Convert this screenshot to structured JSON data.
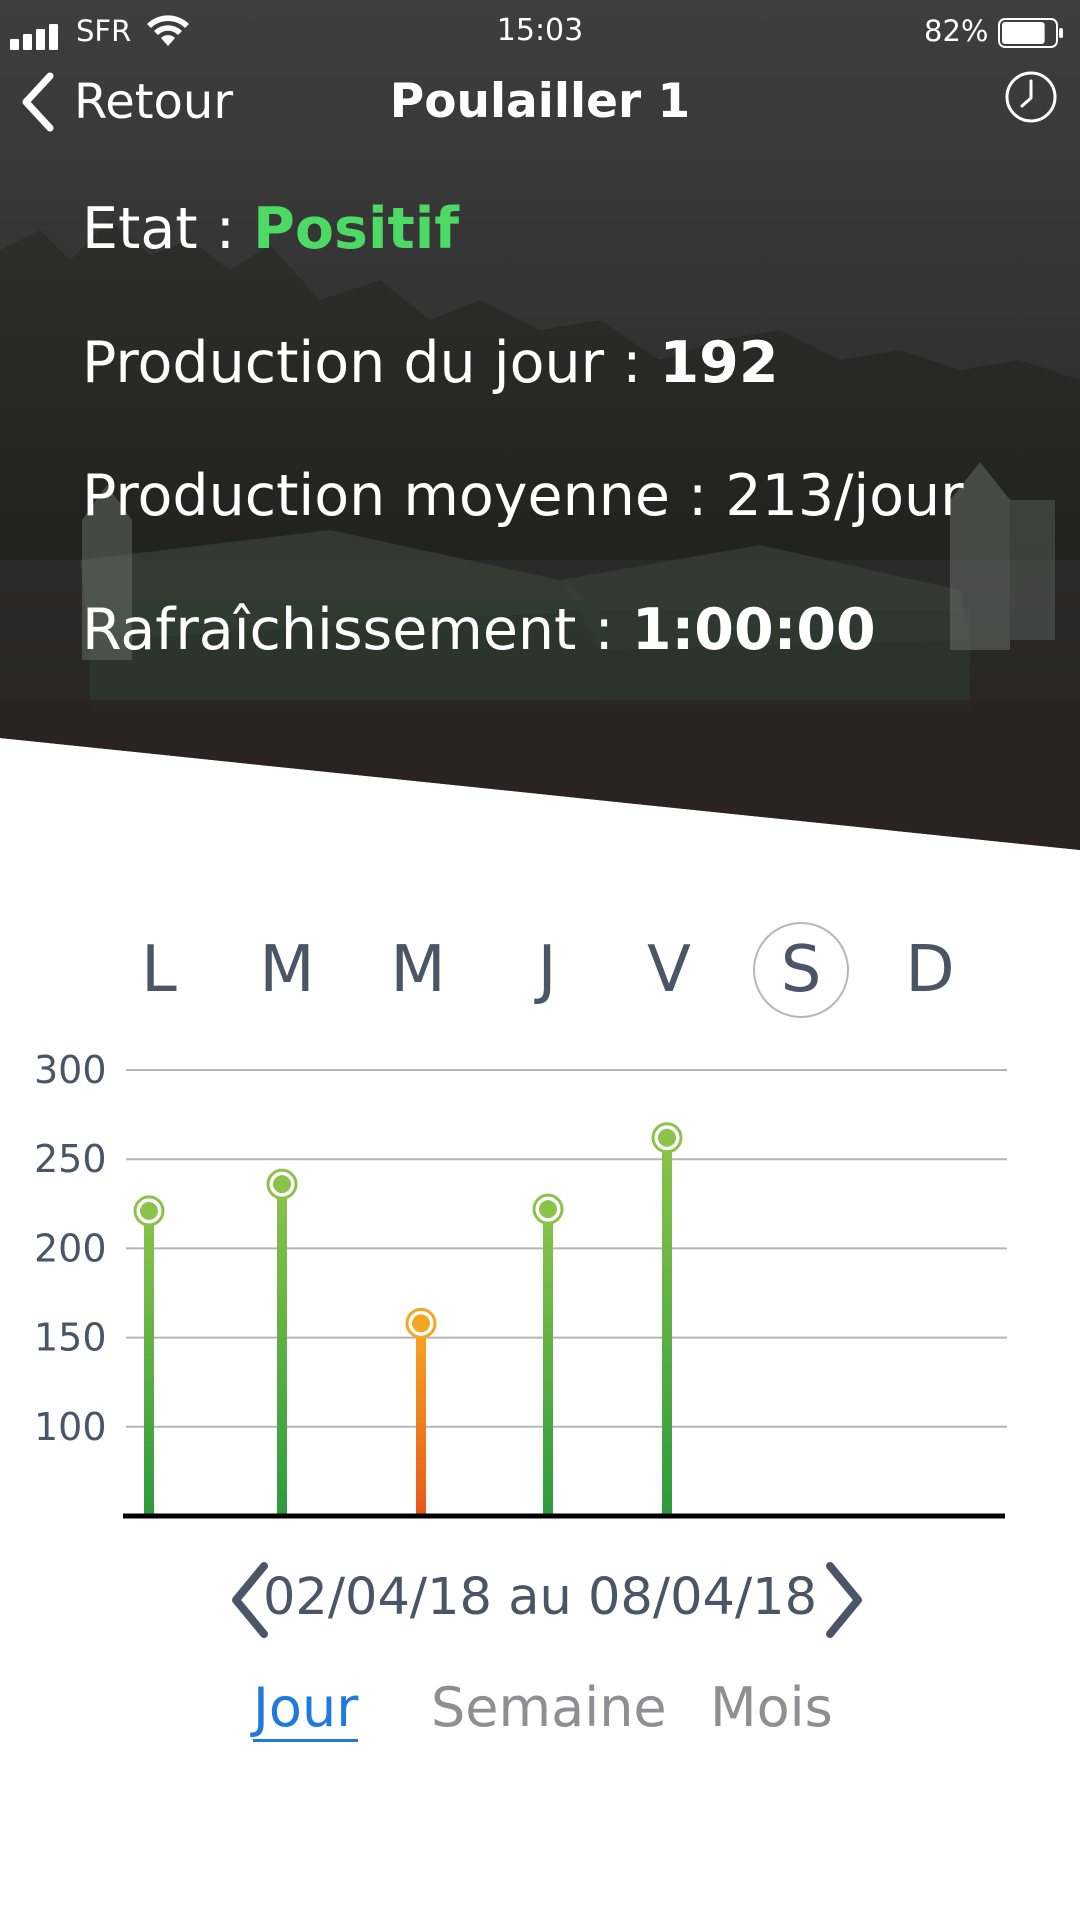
{
  "status_bar": {
    "carrier": "SFR",
    "time": "15:03",
    "battery_percent": "82%",
    "battery_level": 0.82,
    "signal_icon": "signal-bars-icon",
    "wifi_icon": "wifi-icon",
    "battery_icon": "battery-icon"
  },
  "nav": {
    "back_label": "Retour",
    "back_icon": "chevron-left-icon",
    "title": "Poulailler 1",
    "history_icon": "clock-icon"
  },
  "stats": {
    "etat": {
      "label": "Etat : ",
      "value": "Positif",
      "color": "#4cd964"
    },
    "production_jour": {
      "label": "Production du jour : ",
      "value": "192"
    },
    "production_moyenne": {
      "label": "Production moyenne : ",
      "value": "213/jour"
    },
    "rafraichissement": {
      "label": "Rafraîchissement : ",
      "value": "1:00:00"
    }
  },
  "days": [
    "L",
    "M",
    "M",
    "J",
    "V",
    "S",
    "D"
  ],
  "selected_day": "S",
  "chart_data": {
    "type": "bar",
    "categories": [
      "L",
      "M",
      "M",
      "J",
      "V",
      "S",
      "D"
    ],
    "values": [
      221,
      236,
      158,
      222,
      262,
      null,
      null
    ],
    "ylim": [
      50,
      300
    ],
    "yticks": [
      100,
      150,
      200,
      250,
      300
    ],
    "grid": true,
    "colors": {
      "normal_top": "#8bc34a",
      "normal_bottom": "#2e9b3e",
      "low_top": "#f5a623",
      "low_bottom": "#e8581c",
      "low_category": "M (mercredi)"
    }
  },
  "date_nav": {
    "range_text": "02/04/18 au 08/04/18",
    "prev_icon": "chevron-left-icon",
    "next_icon": "chevron-right-icon"
  },
  "period_tabs": {
    "jour": "Jour",
    "semaine": "Semaine",
    "mois": "Mois",
    "active": "Jour"
  }
}
